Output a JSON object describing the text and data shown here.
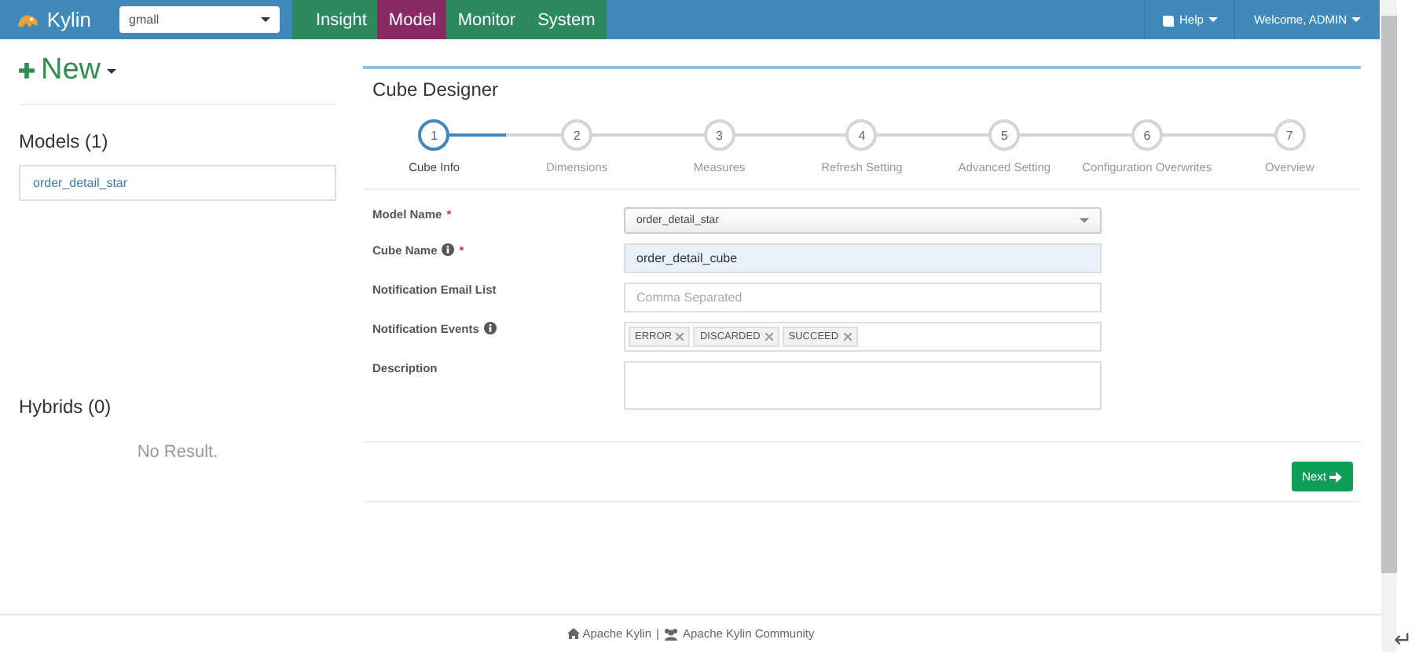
{
  "navbar": {
    "brand": "Kylin",
    "project": "gmall",
    "tabs": [
      {
        "label": "Insight",
        "selected": false
      },
      {
        "label": "Model",
        "selected": true
      },
      {
        "label": "Monitor",
        "selected": false
      },
      {
        "label": "System",
        "selected": false
      }
    ],
    "help": "Help",
    "user": "Welcome, ADMIN"
  },
  "sidebar": {
    "new_button": "New",
    "models_title": "Models (1)",
    "models": [
      "order_detail_star"
    ],
    "hybrids_title": "Hybrids (0)",
    "hybrids_empty": "No Result."
  },
  "designer": {
    "title": "Cube Designer",
    "steps": [
      {
        "number": "1",
        "label": "Cube Info",
        "selected": true
      },
      {
        "number": "2",
        "label": "Dimensions",
        "selected": false
      },
      {
        "number": "3",
        "label": "Measures",
        "selected": false
      },
      {
        "number": "4",
        "label": "Refresh Setting",
        "selected": false
      },
      {
        "number": "5",
        "label": "Advanced Setting",
        "selected": false
      },
      {
        "number": "6",
        "label": "Configuration Overwrites",
        "selected": false
      },
      {
        "number": "7",
        "label": "Overview",
        "selected": false
      }
    ],
    "fields": [
      {
        "kind": "select",
        "label": "Model Name",
        "info": false,
        "required_mark": "*",
        "value": "order_detail_star"
      },
      {
        "kind": "text",
        "label": "Cube Name",
        "info": true,
        "required_mark": "*",
        "value": "order_detail_cube",
        "focused": true
      },
      {
        "kind": "text",
        "label": "Notification Email List",
        "info": false,
        "placeholder": "Comma Separated",
        "focused": false
      },
      {
        "kind": "tags",
        "label": "Notification Events",
        "info": true,
        "tags": [
          "ERROR",
          "DISCARDED",
          "SUCCEED"
        ]
      },
      {
        "kind": "textarea",
        "label": "Description",
        "info": false
      }
    ],
    "next_button": "Next"
  },
  "footer": {
    "home_link": "Apache Kylin",
    "separator": "|",
    "community_link": "Apache Kylin Community"
  },
  "corner_mark": "↵"
}
